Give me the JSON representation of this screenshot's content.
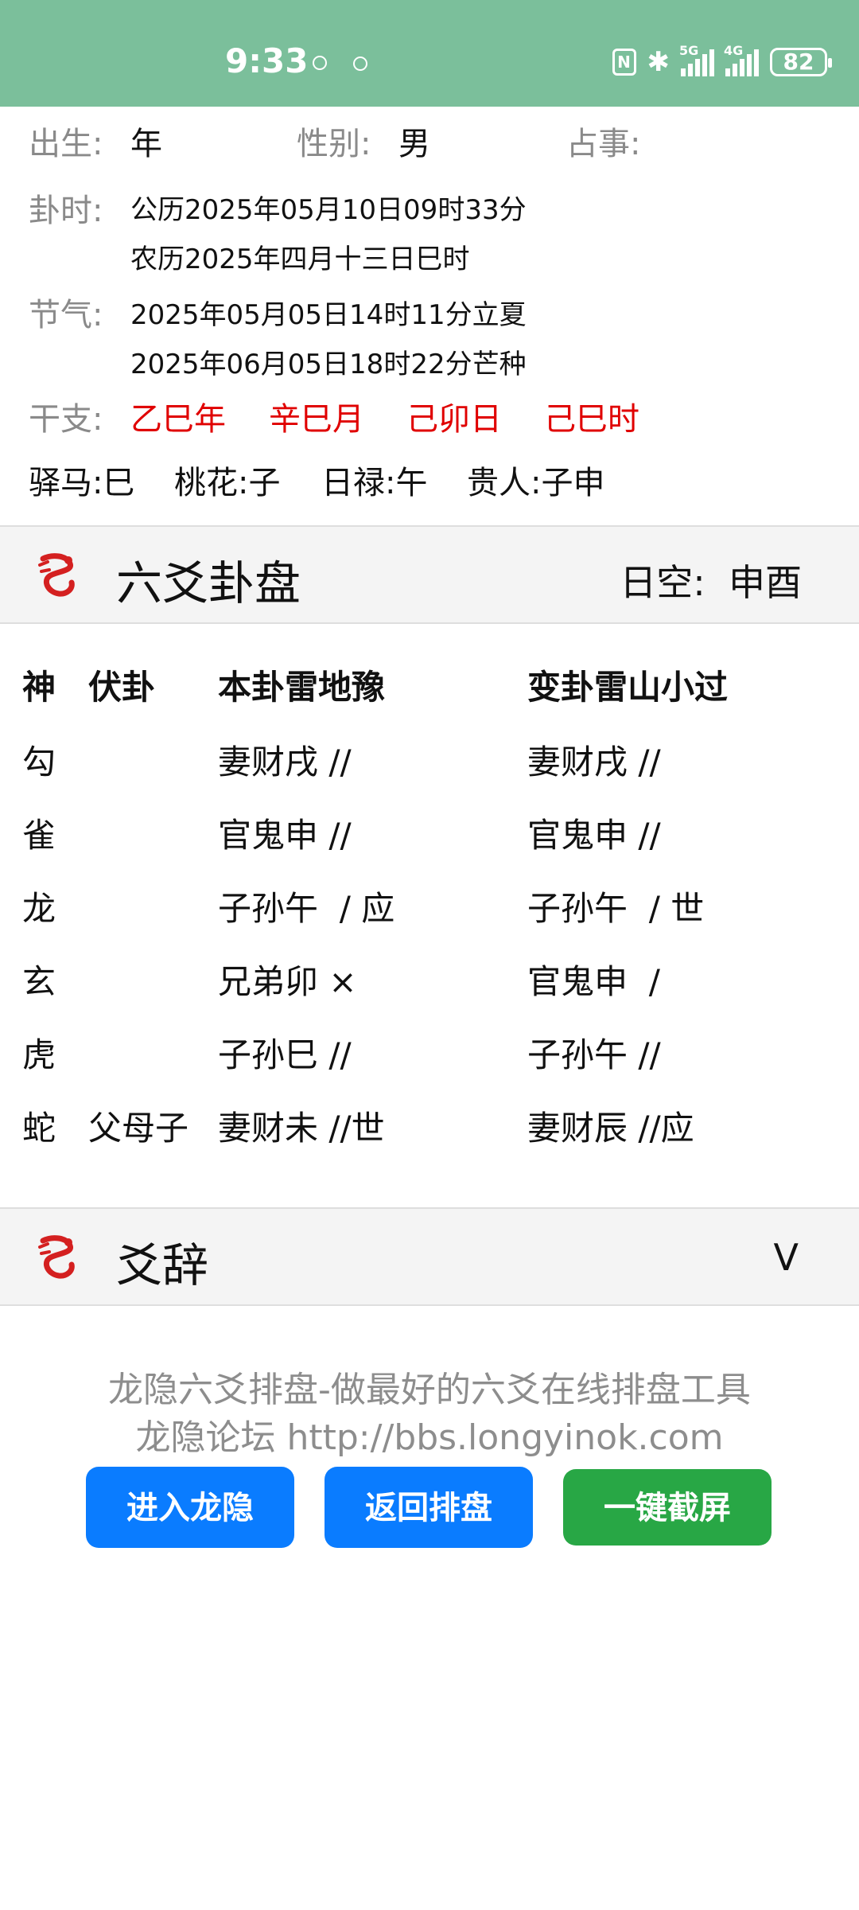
{
  "status_bar": {
    "time": "9:33",
    "signal1_label": "5G",
    "signal2_label": "4G",
    "battery": "82",
    "nfc_label": "N",
    "bluetooth_glyph": "✱"
  },
  "info": {
    "birth_label": "出生:",
    "birth_value": "年",
    "gender_label": "性别:",
    "gender_value": "男",
    "matter_label": "占事:",
    "time_label": "卦时:",
    "gregorian": "公历2025年05月10日09时33分",
    "lunar": "农历2025年四月十三日巳时",
    "solar_term_label": "节气:",
    "term1": "2025年05月05日14时11分立夏",
    "term2": "2025年06月05日18时22分芒种",
    "ganzhi_label": "干支:",
    "ganzhi": [
      "乙巳年",
      "辛巳月",
      "己卯日",
      "己巳时"
    ],
    "extras": [
      "驿马:巳",
      "桃花:子",
      "日禄:午",
      "贵人:子申"
    ]
  },
  "section1": {
    "title": "六爻卦盘",
    "void_label": "日空:",
    "void_value": "申酉"
  },
  "table": {
    "headers": [
      "神",
      "伏卦",
      "本卦雷地豫",
      "变卦雷山小过"
    ],
    "rows": [
      {
        "god": "勾",
        "hidden": "",
        "main": "妻财戌 //",
        "changed": "妻财戌 //"
      },
      {
        "god": "雀",
        "hidden": "",
        "main": "官鬼申 //",
        "changed": "官鬼申 //"
      },
      {
        "god": "龙",
        "hidden": "",
        "main": "子孙午  / 应",
        "changed": "子孙午  / 世"
      },
      {
        "god": "玄",
        "hidden": "",
        "main": "兄弟卯 ×",
        "changed": "官鬼申  /"
      },
      {
        "god": "虎",
        "hidden": "",
        "main": "子孙巳 //",
        "changed": "子孙午 //"
      },
      {
        "god": "蛇",
        "hidden": "父母子",
        "main": "妻财未 //世",
        "changed": "妻财辰 //应"
      }
    ]
  },
  "section2": {
    "title": "爻辞",
    "toggle": "V"
  },
  "footer": {
    "line1": "龙隐六爻排盘-做最好的六爻在线排盘工具",
    "line2": "龙隐论坛 http://bbs.longyinok.com",
    "buttons": [
      "进入龙隐",
      "返回排盘",
      "一键截屏"
    ]
  },
  "colors": {
    "status_bar": "#7bbf9b",
    "ganzhi": "#e00000",
    "primary_button": "#0a7cff",
    "screenshot_button": "#28a745"
  }
}
